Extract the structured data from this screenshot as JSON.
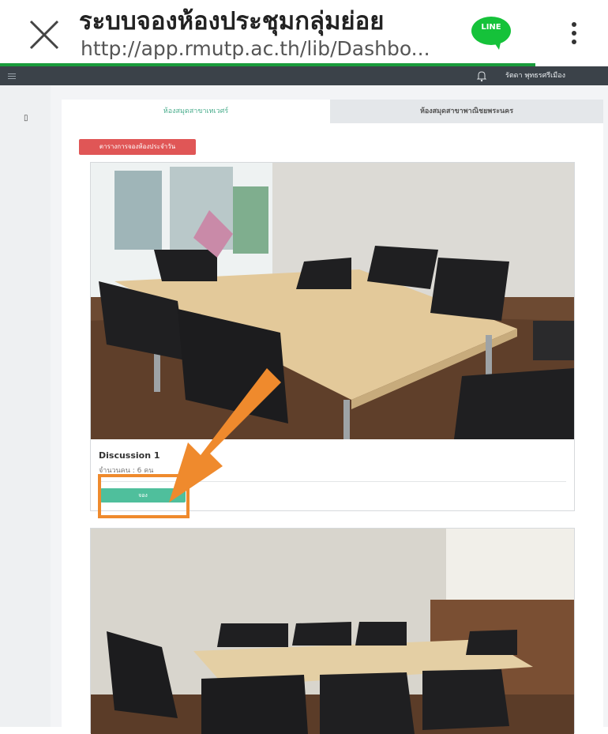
{
  "browser": {
    "title": "ระบบจองห้องประชุมกลุ่มย่อย",
    "url": "http://app.rmutp.ac.th/lib/Dashbo...",
    "line_badge": "LINE",
    "progress_fraction": 0.88,
    "accent": "#1a9c3c"
  },
  "navbar": {
    "user_name": "รัตดา พุทธรศรีเมือง",
    "background": "#3b4249"
  },
  "tabs": [
    {
      "label": "ห้องสมุดสาขาเทเวศร์",
      "active": true
    },
    {
      "label": "ห้องสมุดสาขาพาณิชยพระนคร",
      "active": false
    }
  ],
  "schedule_button": {
    "label": "ตารางการจองห้องประจำวัน",
    "color": "#e05656"
  },
  "rooms": [
    {
      "name": "Discussion 1",
      "capacity": "จำนวนคน : 6 คน",
      "book_label": "จอง",
      "button_color": "#4fbf9c"
    },
    {
      "name": "",
      "capacity": "",
      "book_label": ""
    }
  ],
  "annotation": {
    "highlight_color": "#ef8a2d"
  }
}
